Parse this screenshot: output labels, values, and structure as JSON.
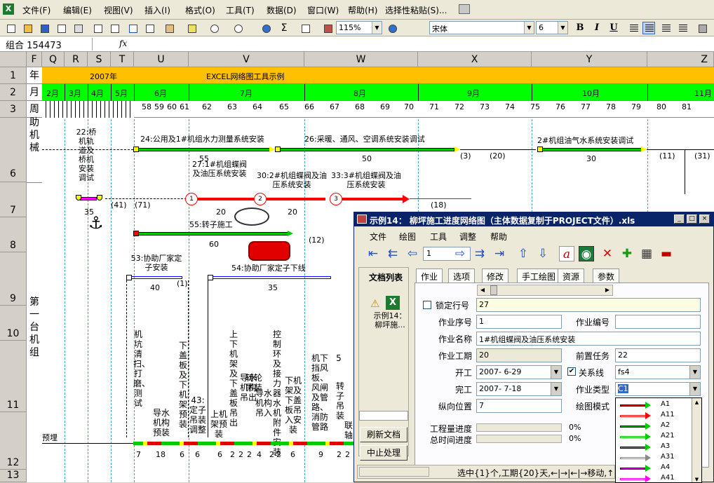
{
  "menubar": {
    "items": [
      "文件(F)",
      "编辑(E)",
      "视图(V)",
      "插入(I)",
      "格式(O)",
      "工具(T)",
      "数据(D)",
      "窗口(W)",
      "帮助(H)",
      "选择性粘贴(S)..."
    ]
  },
  "toolbar": {
    "zoom": "115%",
    "font": "宋体",
    "size": "6"
  },
  "formulabar": {
    "namebox": "组合 154473",
    "fx": "fx",
    "content": ""
  },
  "columns": [
    "F",
    "Q",
    "R",
    "S",
    "T",
    "U",
    "V",
    "W",
    "X",
    "Y",
    "Z"
  ],
  "rows": [
    "1",
    "2",
    "3",
    "6",
    "7",
    "8",
    "9",
    "10",
    "11",
    "12",
    "13"
  ],
  "header_labels": {
    "year": "年",
    "month": "月",
    "week": "周",
    "year_value": "2007年",
    "tool_title": "EXCEL网络图工具示例"
  },
  "months": [
    "2月",
    "3月",
    "4月",
    "5月",
    "6月",
    "7月",
    "8月",
    "9月",
    "10月",
    "11月"
  ],
  "weeks": [
    "58",
    "59",
    "60",
    "61",
    "62",
    "63",
    "64",
    "65",
    "66",
    "67",
    "68",
    "69",
    "70",
    "71",
    "72",
    "73",
    "74",
    "75",
    "76",
    "77",
    "78",
    "79",
    "80",
    "81"
  ],
  "left_labels": {
    "top": "助机械",
    "main": "第一台机组",
    "row12": "预埋"
  },
  "tasks": {
    "t22": "22:桥机轨道及桥机安装调试",
    "t24": "24:公用及1#机组水力测量系统安装",
    "t26": "26:采暖、通风、空调系统安装调试",
    "t2oil": "2#机组油气水系统安装调试",
    "t27": "27:1#机组蝶阀及油压系统安装",
    "t30": "30:2#机组蝶阀及油压系统安装",
    "t33": "33:3#机组蝶阀及油压系统安装",
    "t55": "55:转子施工",
    "t53": "53:协助厂家定子安装",
    "t54": "54:协助厂家定子下线"
  },
  "durations": {
    "d35": "35",
    "d41": "(41)",
    "d71": "(71)",
    "d55": "55",
    "d50": "50",
    "d3": "(3)",
    "d20a": "(20)",
    "d30": "30",
    "d11": "(11)",
    "d31": "(31)",
    "d20b": "20",
    "d20c": "20",
    "d18": "(18)",
    "d60": "60",
    "d12": "(12)",
    "d40": "40",
    "d1": "(1)",
    "d35b": "35"
  },
  "vertical_tasks": [
    "机坑清扫、打磨、测试",
    "导水机构预装",
    "下盖板及下机架预装",
    "43:定子吊装调整",
    "上机架预装",
    "上下机架及下盖板吊出",
    "导水机构吊出",
    "转轮吊装",
    "导水机构吊入",
    "控制环及接力器水机附件安装",
    "下机架及下盖板吊入安装",
    "机下挡风板、风闸及管路、消防管路",
    "5",
    "转子吊装",
    "联轴"
  ],
  "row12_durations": [
    "7",
    "18",
    "6",
    "6",
    "6",
    "2",
    "2",
    "2",
    "4",
    "2",
    "2",
    "6",
    "9",
    "2",
    "2"
  ],
  "node_labels": [
    "1",
    "2",
    "3"
  ],
  "dialog": {
    "title": "示例14： 柳坪施工进度网络图（主体数据复制于PROJECT文件）.xls",
    "menus": [
      "文件",
      "绘图",
      "工具",
      "调整",
      "帮助"
    ],
    "nav_value": "1",
    "doclist_label": "文档列表",
    "doc_item": "示例14：柳坪施...",
    "tabs": [
      "作业",
      "选项",
      "修改",
      "手工绘图",
      "资源",
      "参数"
    ],
    "lock_label": "锁定行号",
    "lock_value": "27",
    "seq_label": "作业序号",
    "seq_value": "1",
    "code_label": "作业编号",
    "code_value": "",
    "name_label": "作业名称",
    "name_value": "1#机组蝶阀及油压系统安装",
    "duration_label": "作业工期",
    "duration_value": "20",
    "pred_label": "前置任务",
    "pred_value": "22",
    "start_label": "开工",
    "start_value": "2007- 6-29",
    "relation_label": "关系线",
    "relation_value": "fs4",
    "finish_label": "完工",
    "finish_value": "2007- 7-18",
    "type_label": "作业类型",
    "type_value": "C1",
    "vpos_label": "纵向位置",
    "vpos_value": "7",
    "mode_label": "绘图模式",
    "progress_label": "工程量进度",
    "progress_value": "0%",
    "time_label": "总时间进度",
    "time_value": "0%",
    "refresh_btn": "刷新文档",
    "stop_btn": "中止处理",
    "status": "选中{1}个,工期{20}天,←|→|←|→移动,↑",
    "line_types": [
      "A1",
      "A11",
      "A2",
      "A21",
      "A3",
      "A31",
      "A4",
      "A41"
    ],
    "line_colors": [
      "#ff0000",
      "#ff0000",
      "#00cc00",
      "#00cc00",
      "#888888",
      "#888888",
      "#ff00ff",
      "#ff00ff"
    ]
  }
}
